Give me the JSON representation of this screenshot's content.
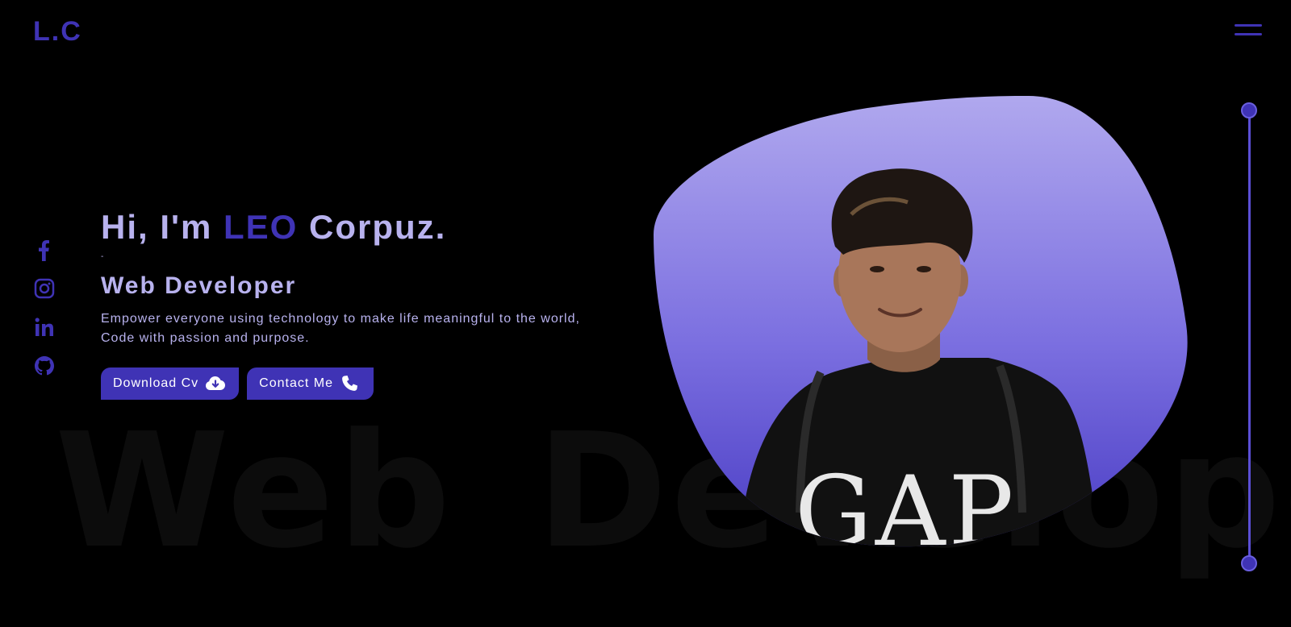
{
  "logo": "L.C",
  "hero": {
    "greeting": "Hi, I'm ",
    "first_name": "LEO",
    "last_name": " Corpuz.",
    "cursor": "-",
    "role": "Web Developer",
    "description_line1": "Empower everyone using technology to make life meaningful to the world,",
    "description_line2": "Code with passion and purpose."
  },
  "buttons": {
    "download_cv": "Download Cv",
    "contact_me": "Contact Me"
  },
  "watermark": "Web Developer",
  "socials": [
    "facebook-icon",
    "instagram-icon",
    "linkedin-icon",
    "github-icon"
  ],
  "colors": {
    "accent": "#3f33b5",
    "text_light": "#b8b2ee",
    "background": "#000000",
    "blob_top": "#b0a8ee",
    "blob_bottom": "#4a3dc4"
  }
}
